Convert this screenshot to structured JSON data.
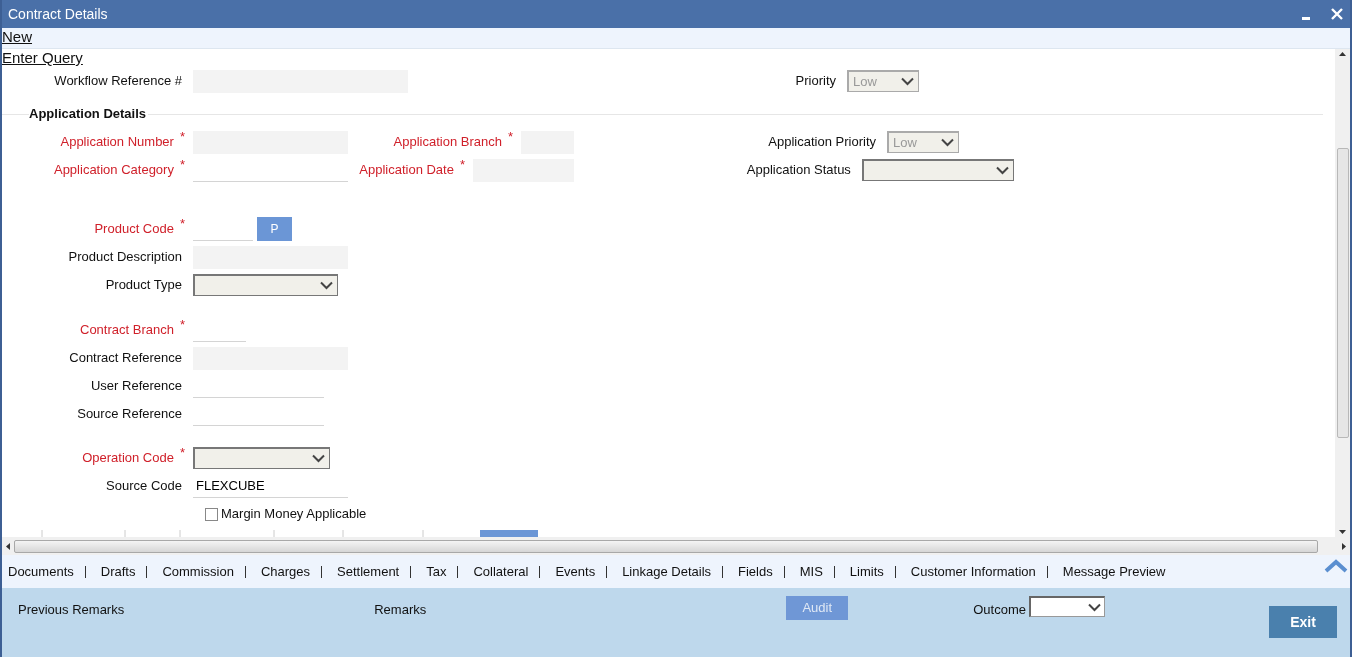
{
  "window": {
    "title": "Contract Details"
  },
  "actions": [
    {
      "label": "New"
    },
    {
      "label": "Enter Query"
    }
  ],
  "header_fields": [
    {
      "kind": "text",
      "label": "Workflow Reference #",
      "required": false,
      "readonly": true
    },
    {
      "kind": "select",
      "label": "Priority",
      "required": false,
      "value": "Low",
      "disabled": true
    }
  ],
  "section_title": "Application Details",
  "application_columns": [
    [
      {
        "kind": "text",
        "label": "Application Number",
        "required": true,
        "mark": "*",
        "readonly": true
      },
      {
        "kind": "text",
        "label": "Application Category",
        "required": true,
        "mark": "*",
        "readonly": false
      }
    ],
    [
      {
        "kind": "text",
        "label": "Application Branch",
        "required": true,
        "mark": "*",
        "readonly": true
      },
      {
        "kind": "text",
        "label": "Application Date",
        "required": true,
        "mark": "*",
        "readonly": true
      }
    ],
    [
      {
        "kind": "select",
        "label": "Application Priority",
        "required": false,
        "value": "Low",
        "disabled": true
      },
      {
        "kind": "select",
        "label": "Application Status",
        "required": false,
        "disabled": false
      }
    ]
  ],
  "groups": [
    [
      {
        "kind": "text",
        "label": "Product Code",
        "required": true,
        "mark": "*",
        "readonly": false,
        "button": "P"
      },
      {
        "kind": "text",
        "label": "Product Description",
        "required": false,
        "readonly": true
      },
      {
        "kind": "select",
        "label": "Product Type",
        "required": false,
        "disabled": false
      }
    ],
    [
      {
        "kind": "text",
        "label": "Contract Branch",
        "required": true,
        "mark": "*",
        "readonly": false
      },
      {
        "kind": "text",
        "label": "Contract Reference",
        "required": false,
        "readonly": true
      },
      {
        "kind": "text",
        "label": "User Reference",
        "required": false,
        "readonly": false
      },
      {
        "kind": "text",
        "label": "Source Reference",
        "required": false,
        "readonly": false
      }
    ],
    [
      {
        "kind": "select",
        "label": "Operation Code",
        "required": true,
        "mark": "*",
        "disabled": false
      },
      {
        "kind": "text",
        "label": "Source Code",
        "required": false,
        "readonly": false,
        "value": "FLEXCUBE"
      },
      {
        "kind": "checkbox",
        "label": "Margin Money Applicable",
        "checked": false
      }
    ]
  ],
  "tabs": [
    {
      "label": "Documents"
    },
    {
      "label": "Drafts"
    },
    {
      "label": "Commission"
    },
    {
      "label": "Charges"
    },
    {
      "label": "Settlement"
    },
    {
      "label": "Tax"
    },
    {
      "label": "Collateral"
    },
    {
      "label": "Events"
    },
    {
      "label": "Linkage Details"
    },
    {
      "label": "Fields"
    },
    {
      "label": "MIS"
    },
    {
      "label": "Limits"
    },
    {
      "label": "Customer Information"
    },
    {
      "label": "Message Preview"
    }
  ],
  "footer": {
    "previous_remarks": "Previous Remarks",
    "remarks": "Remarks",
    "audit": {
      "label": "Audit",
      "disabled": true
    },
    "outcome": {
      "label": "Outcome"
    },
    "exit": {
      "label": "Exit"
    }
  }
}
